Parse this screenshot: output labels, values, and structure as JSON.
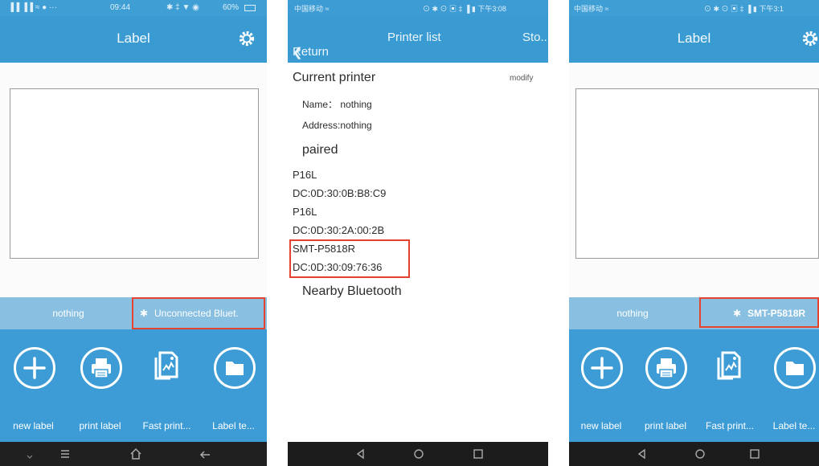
{
  "screens": [
    {
      "status": {
        "signal": "▐▐ ▐▐ ≈ ● ···",
        "time": "09:44",
        "icons": "✱ ‡ ▼ ◉",
        "battery": "60%"
      },
      "header": {
        "title": "Label",
        "icon": "gear-icon"
      },
      "bar": {
        "left": "nothing",
        "bt_icon": "bluetooth-icon",
        "right": "Unconnected Bluet."
      },
      "actions": [
        {
          "icon": "plus-icon",
          "label": "new label"
        },
        {
          "icon": "printer-icon",
          "label": "print label"
        },
        {
          "icon": "fast-print-icon",
          "label": "Fast print..."
        },
        {
          "icon": "folder-icon",
          "label": "Label te..."
        }
      ],
      "nav": [
        "menu-icon",
        "home-icon",
        "back-icon"
      ]
    },
    {
      "status": {
        "left": "中国移动 ≈",
        "right": "⊙ ✱ ⊙ ▣ ‡ ▐ ▮ 下午3:08"
      },
      "header": {
        "back": "Return",
        "title": "Printer list",
        "right": "Sto.."
      },
      "current": {
        "heading": "Current printer",
        "action": "modify",
        "name": "Name： nothing",
        "address": "Address:nothing"
      },
      "paired": {
        "heading": "paired",
        "devices": [
          {
            "name": "P16L",
            "mac": "DC:0D:30:0B:B8:C9"
          },
          {
            "name": "P16L",
            "mac": "DC:0D:30:2A:00:2B"
          },
          {
            "name": "SMT-P5818R",
            "mac": "DC:0D:30:09:76:36"
          }
        ]
      },
      "nearby": "Nearby Bluetooth"
    },
    {
      "status": {
        "left": "中国移动 ≈",
        "right": "⊙ ✱ ⊙ ▣ ‡ ▐ ▮ 下午3:1"
      },
      "header": {
        "title": "Label",
        "icon": "gear-icon"
      },
      "bar": {
        "left": "nothing",
        "bt_icon": "bluetooth-icon",
        "right": "SMT-P5818R"
      },
      "actions": [
        {
          "icon": "plus-icon",
          "label": "new label"
        },
        {
          "icon": "printer-icon",
          "label": "print label"
        },
        {
          "icon": "fast-print-icon",
          "label": "Fast print..."
        },
        {
          "icon": "folder-icon",
          "label": "Label te..."
        }
      ]
    }
  ]
}
